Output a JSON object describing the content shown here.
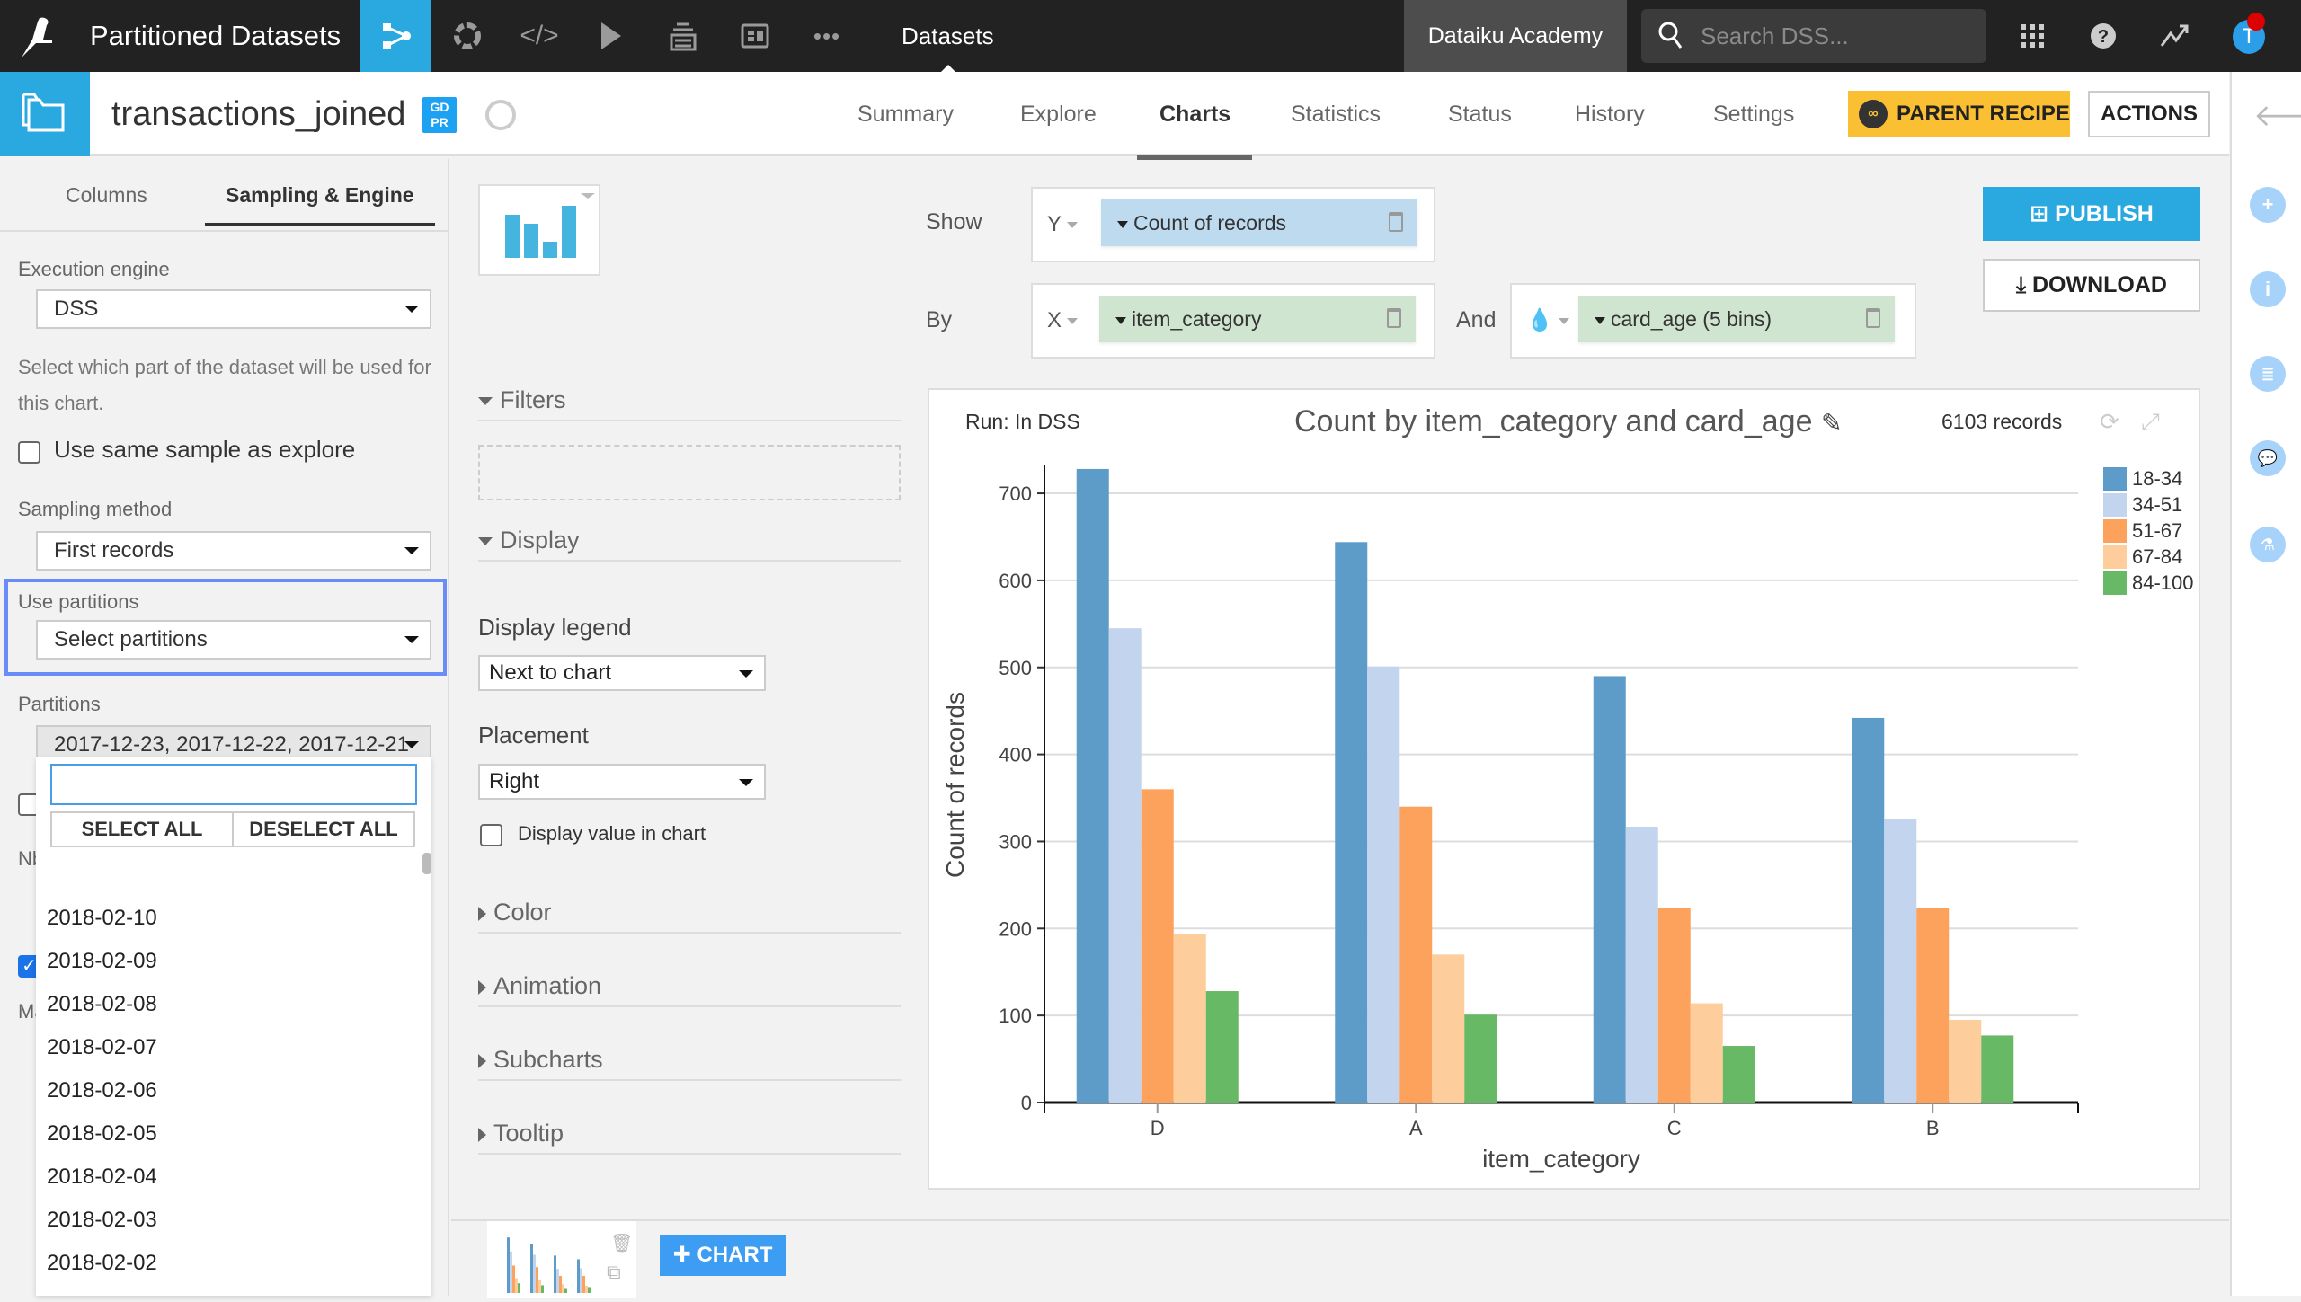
{
  "topbar": {
    "project_title": "Partitioned Datasets",
    "nav_icons": [
      "flow-icon",
      "lab-icon",
      "code-icon",
      "run-icon",
      "deploy-icon",
      "dashboard-icon",
      "more-icon"
    ],
    "section": "Datasets",
    "instance": "Dataiku Academy",
    "search_placeholder": "Search DSS...",
    "avatar_initial": "T"
  },
  "dataset": {
    "name": "transactions_joined",
    "gdpr_badge": "GD PR",
    "tabs": [
      "Summary",
      "Explore",
      "Charts",
      "Statistics",
      "Status",
      "History",
      "Settings"
    ],
    "active_tab": "Charts",
    "parent_recipe_label": "PARENT RECIPE",
    "actions_label": "ACTIONS"
  },
  "left_panel": {
    "tabs": [
      "Columns",
      "Sampling & Engine"
    ],
    "active_tab": "Sampling & Engine",
    "execution_engine_label": "Execution engine",
    "execution_engine_value": "DSS",
    "help_text": "Select which part of the dataset will be used for this chart.",
    "same_sample_label": "Use same sample as explore",
    "same_sample_checked": false,
    "sampling_method_label": "Sampling method",
    "sampling_method_value": "First records",
    "use_partitions_label": "Use partitions",
    "use_partitions_value": "Select partitions",
    "partitions_label": "Partitions",
    "partitions_value": "2017-12-23, 2017-12-22, 2017-12-21",
    "hidden_label_nb": "Nb",
    "hidden_label_ma": "Ma",
    "hidden_checkbox_checked": true,
    "dropdown": {
      "search_value": "",
      "select_all": "SELECT ALL",
      "deselect_all": "DESELECT ALL",
      "items": [
        "2018-02-10",
        "2018-02-09",
        "2018-02-08",
        "2018-02-07",
        "2018-02-06",
        "2018-02-05",
        "2018-02-04",
        "2018-02-03",
        "2018-02-02"
      ]
    }
  },
  "mid_panel": {
    "filters": "Filters",
    "display": "Display",
    "display_legend_label": "Display legend",
    "display_legend_value": "Next to chart",
    "placement_label": "Placement",
    "placement_value": "Right",
    "display_value_label": "Display value in chart",
    "display_value_checked": false,
    "sections": [
      "Color",
      "Animation",
      "Subcharts",
      "Tooltip"
    ]
  },
  "config": {
    "show_label": "Show",
    "by_label": "By",
    "and_label": "And",
    "y_axis": "Y",
    "x_axis": "X",
    "y_measure": "Count of records",
    "x_dimension": "item_category",
    "color_dimension": "card_age (5 bins)"
  },
  "buttons": {
    "publish": "PUBLISH",
    "download": "DOWNLOAD",
    "add_chart": "CHART"
  },
  "chart_header": {
    "run": "Run: In DSS",
    "records": "6103 records"
  },
  "colors": {
    "accent": "#29a9e0",
    "parent_recipe": "#fbbf33"
  },
  "chart_data": {
    "type": "bar",
    "title": "Count by item_category and card_age",
    "xlabel": "item_category",
    "ylabel": "Count of records",
    "categories": [
      "D",
      "A",
      "C",
      "B"
    ],
    "ylim": [
      0,
      730
    ],
    "yticks": [
      0,
      100,
      200,
      300,
      400,
      500,
      600,
      700
    ],
    "grid": true,
    "legend_position": "right",
    "series": [
      {
        "name": "18-34",
        "color": "#5d9bc8",
        "values": [
          728,
          644,
          490,
          442
        ]
      },
      {
        "name": "34-51",
        "color": "#c3d5ee",
        "values": [
          545,
          501,
          317,
          326
        ]
      },
      {
        "name": "51-67",
        "color": "#fda25c",
        "values": [
          360,
          340,
          224,
          224
        ]
      },
      {
        "name": "67-84",
        "color": "#fdcd9b",
        "values": [
          194,
          170,
          114,
          95
        ]
      },
      {
        "name": "84-100",
        "color": "#67b966",
        "values": [
          128,
          101,
          65,
          77
        ]
      }
    ]
  }
}
